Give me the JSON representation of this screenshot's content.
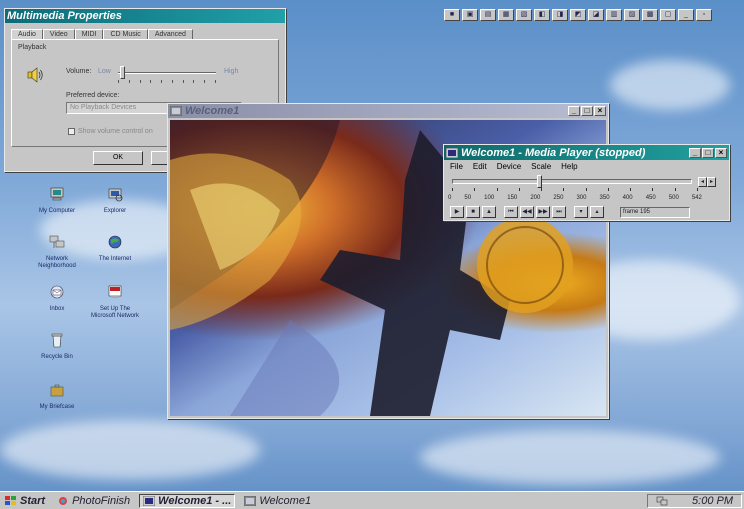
{
  "multimedia": {
    "title": "Multimedia Properties",
    "tabs": [
      "Audio",
      "Video",
      "MIDI",
      "CD Music",
      "Advanced"
    ],
    "section": "Playback",
    "volume_label": "Volume:",
    "low": "Low",
    "high": "High",
    "preferred_device_label": "Preferred device:",
    "preferred_device_value": "No Playback Devices",
    "show_volume_label": "Show volume control on",
    "ok_label": "OK"
  },
  "desktop": {
    "icons": [
      {
        "label": "My Computer"
      },
      {
        "label": "Explorer"
      },
      {
        "label": "Network Neighborhood"
      },
      {
        "label": "The Internet"
      },
      {
        "label": "Inbox"
      },
      {
        "label": "Set Up The Microsoft Network"
      },
      {
        "label": "Recycle Bin"
      },
      {
        "label": "My Briefcase"
      }
    ]
  },
  "welcome_window": {
    "title": "Welcome1"
  },
  "media_player": {
    "title": "Welcome1 - Media Player (stopped)",
    "menu": [
      "File",
      "Edit",
      "Device",
      "Scale",
      "Help"
    ],
    "scale": [
      "0",
      "50",
      "100",
      "150",
      "200",
      "250",
      "300",
      "350",
      "400",
      "450",
      "500",
      "542"
    ],
    "frame_text": "frame 195",
    "position_fraction": 0.36
  },
  "taskbar": {
    "start": "Start",
    "items": [
      "PhotoFinish",
      "Welcome1 - ...",
      "Welcome1"
    ],
    "clock": "5:00 PM"
  },
  "colors": {
    "title_active": "#1d1e8c",
    "title_teal": "#0e6a6a",
    "title_inactive": "#8a8fa8",
    "desktop": "#7fa8d8"
  }
}
